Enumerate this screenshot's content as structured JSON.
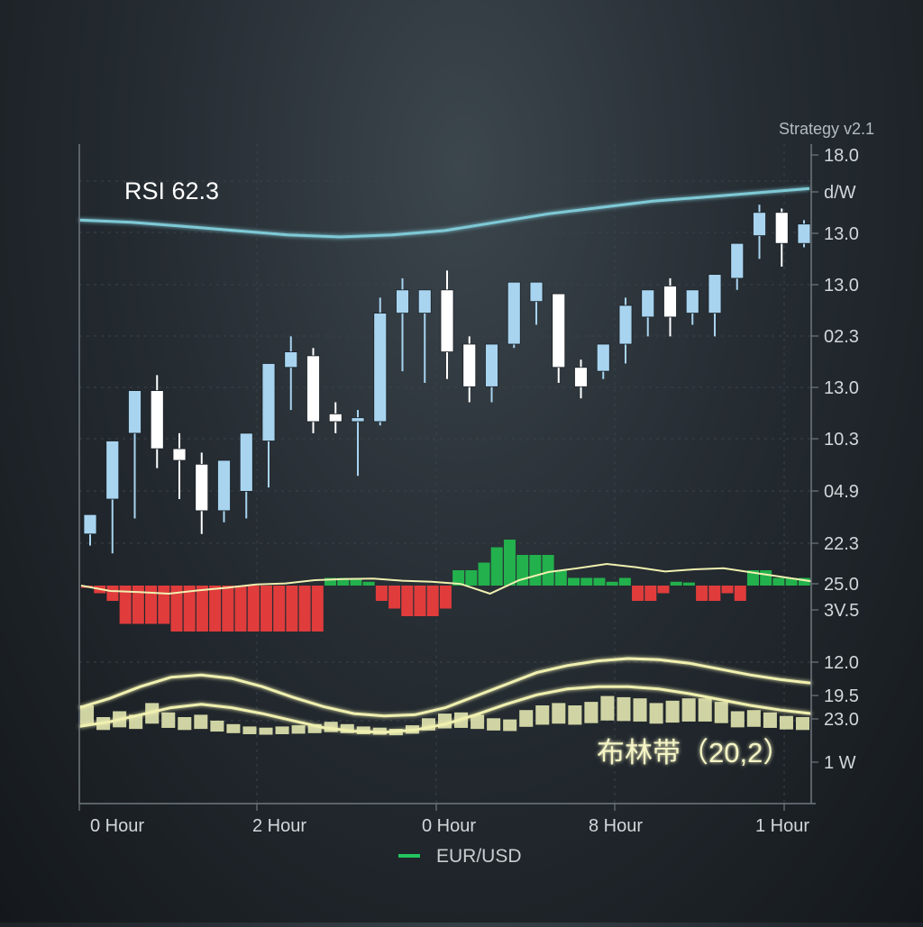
{
  "strategy_label": "Strategy v2.1",
  "rsi_label": "RSI 62.3",
  "bollinger_label": "布林带（20,2）",
  "y_tick_labels": [
    "18.0",
    "d/W",
    "13.0",
    "13.0",
    "02.3",
    "13.0",
    "10.3",
    "04.9",
    "22.3",
    "25.0",
    "3V.5",
    "12.0",
    "19.5",
    "23.0",
    "1 W"
  ],
  "x_tick_labels": [
    "0 Hour",
    "2 Hour",
    "0 Hour",
    "8 Hour",
    "1 Hour"
  ],
  "legend": {
    "label": "EUR/USD",
    "color": "#22c55e"
  },
  "colors": {
    "bull": "#a8d4f0",
    "bear": "#ffffff",
    "hist_up": "#22b14c",
    "hist_down": "#e03c3c",
    "rsi": "#7fc9d6",
    "band": "#f0f0b0"
  },
  "chart_data": [
    {
      "type": "candlestick",
      "series": [
        {
          "name": "EUR/USD"
        }
      ],
      "candles": [
        {
          "o": 0.31,
          "h": 0.36,
          "l": 0.28,
          "c": 0.36
        },
        {
          "o": 0.4,
          "h": 0.55,
          "l": 0.26,
          "c": 0.55
        },
        {
          "o": 0.57,
          "h": 0.68,
          "l": 0.35,
          "c": 0.68
        },
        {
          "o": 0.68,
          "h": 0.72,
          "l": 0.48,
          "c": 0.53
        },
        {
          "o": 0.53,
          "h": 0.57,
          "l": 0.4,
          "c": 0.5
        },
        {
          "o": 0.49,
          "h": 0.52,
          "l": 0.31,
          "c": 0.37
        },
        {
          "o": 0.37,
          "h": 0.49,
          "l": 0.34,
          "c": 0.5
        },
        {
          "o": 0.42,
          "h": 0.57,
          "l": 0.35,
          "c": 0.57
        },
        {
          "o": 0.55,
          "h": 0.66,
          "l": 0.43,
          "c": 0.75
        },
        {
          "o": 0.74,
          "h": 0.82,
          "l": 0.63,
          "c": 0.78
        },
        {
          "o": 0.77,
          "h": 0.79,
          "l": 0.57,
          "c": 0.6
        },
        {
          "o": 0.62,
          "h": 0.65,
          "l": 0.57,
          "c": 0.6
        },
        {
          "o": 0.6,
          "h": 0.63,
          "l": 0.46,
          "c": 0.61
        },
        {
          "o": 0.6,
          "h": 0.92,
          "l": 0.59,
          "c": 0.88
        },
        {
          "o": 0.88,
          "h": 0.97,
          "l": 0.73,
          "c": 0.94
        },
        {
          "o": 0.88,
          "h": 0.93,
          "l": 0.7,
          "c": 0.94
        },
        {
          "o": 0.94,
          "h": 0.99,
          "l": 0.71,
          "c": 0.78
        },
        {
          "o": 0.8,
          "h": 0.82,
          "l": 0.65,
          "c": 0.69
        },
        {
          "o": 0.69,
          "h": 0.8,
          "l": 0.65,
          "c": 0.8
        },
        {
          "o": 0.8,
          "h": 0.96,
          "l": 0.79,
          "c": 0.96
        },
        {
          "o": 0.91,
          "h": 0.96,
          "l": 0.85,
          "c": 0.96
        },
        {
          "o": 0.93,
          "h": 0.93,
          "l": 0.7,
          "c": 0.74
        },
        {
          "o": 0.74,
          "h": 0.76,
          "l": 0.66,
          "c": 0.69
        },
        {
          "o": 0.73,
          "h": 0.8,
          "l": 0.71,
          "c": 0.8
        },
        {
          "o": 0.8,
          "h": 0.92,
          "l": 0.75,
          "c": 0.9
        },
        {
          "o": 0.87,
          "h": 0.92,
          "l": 0.82,
          "c": 0.94
        },
        {
          "o": 0.95,
          "h": 0.97,
          "l": 0.82,
          "c": 0.87
        },
        {
          "o": 0.88,
          "h": 0.92,
          "l": 0.85,
          "c": 0.94
        },
        {
          "o": 0.88,
          "h": 0.97,
          "l": 0.82,
          "c": 0.98
        },
        {
          "o": 0.97,
          "h": 1.04,
          "l": 0.94,
          "c": 1.06
        },
        {
          "o": 1.08,
          "h": 1.16,
          "l": 1.02,
          "c": 1.14
        },
        {
          "o": 1.14,
          "h": 1.15,
          "l": 1.0,
          "c": 1.06
        },
        {
          "o": 1.06,
          "h": 1.12,
          "l": 1.05,
          "c": 1.11
        }
      ]
    },
    {
      "type": "line",
      "series": [
        {
          "name": "RSI 62.3",
          "values": [
            66,
            65,
            63,
            61,
            59,
            58,
            59,
            61,
            65,
            69,
            72,
            75,
            77,
            79,
            81
          ]
        }
      ]
    },
    {
      "type": "bar",
      "values": [
        -0.3,
        -1,
        -2,
        -5,
        -5,
        -5,
        -5,
        -6,
        -6,
        -6,
        -6,
        -6,
        -6,
        -6,
        -6,
        -6,
        -6,
        -6,
        -6,
        1,
        1,
        1,
        0.5,
        -2,
        -3,
        -4,
        -4,
        -4,
        -3,
        2,
        2,
        3,
        5,
        6,
        4,
        4,
        4,
        2,
        1,
        1,
        1,
        0.5,
        1,
        -2,
        -2,
        -1,
        0.5,
        0.4,
        -2,
        -2,
        -1,
        -2,
        2,
        2,
        1,
        1,
        1
      ]
    },
    {
      "type": "line",
      "series": [
        {
          "name": "MACD signal",
          "values": [
            0,
            -1,
            -1.2,
            -1.5,
            -0.9,
            -0.4,
            0.2,
            0.4,
            1,
            1.2,
            1.3,
            0.9,
            0.7,
            0.3,
            -1.5,
            1,
            2.5,
            3.2,
            4,
            3.4,
            2.6,
            3,
            3.2,
            2.4,
            1.6,
            0.8
          ]
        }
      ]
    },
    {
      "type": "bar",
      "series": [
        {
          "name": "volume",
          "values": [
            3,
            2,
            2.5,
            2.2,
            3.2,
            2.4,
            2,
            2.2,
            1.7,
            1.4,
            1.2,
            1.1,
            1.2,
            1.3,
            1.4,
            1.6,
            1.4,
            1.2,
            1.1,
            1.0,
            1.3,
            1.9,
            2.3,
            2.4,
            2.2,
            1.9,
            1.8,
            2.6,
            3.0,
            3.2,
            3.0,
            3.3,
            3.8,
            3.7,
            3.6,
            3.2,
            3.4,
            3.6,
            3.6,
            3.3,
            2.5,
            2.6,
            2.4,
            2.1,
            2.0
          ]
        }
      ],
      "bands": {
        "upper": [
          2.8,
          3.6,
          4.6,
          5.4,
          5.6,
          5.3,
          4.6,
          3.7,
          2.9,
          2.3,
          2.1,
          2.2,
          2.8,
          3.8,
          4.8,
          5.8,
          6.4,
          6.8,
          7.0,
          6.9,
          6.6,
          6.1,
          5.6,
          5.2,
          4.9
        ],
        "lower": [
          1.2,
          1.6,
          2.2,
          2.8,
          3.1,
          2.8,
          2.3,
          1.7,
          1.1,
          0.8,
          0.7,
          0.9,
          1.4,
          2.2,
          3.1,
          3.9,
          4.4,
          4.6,
          4.6,
          4.4,
          4.0,
          3.5,
          3.0,
          2.6,
          2.3
        ]
      }
    }
  ]
}
